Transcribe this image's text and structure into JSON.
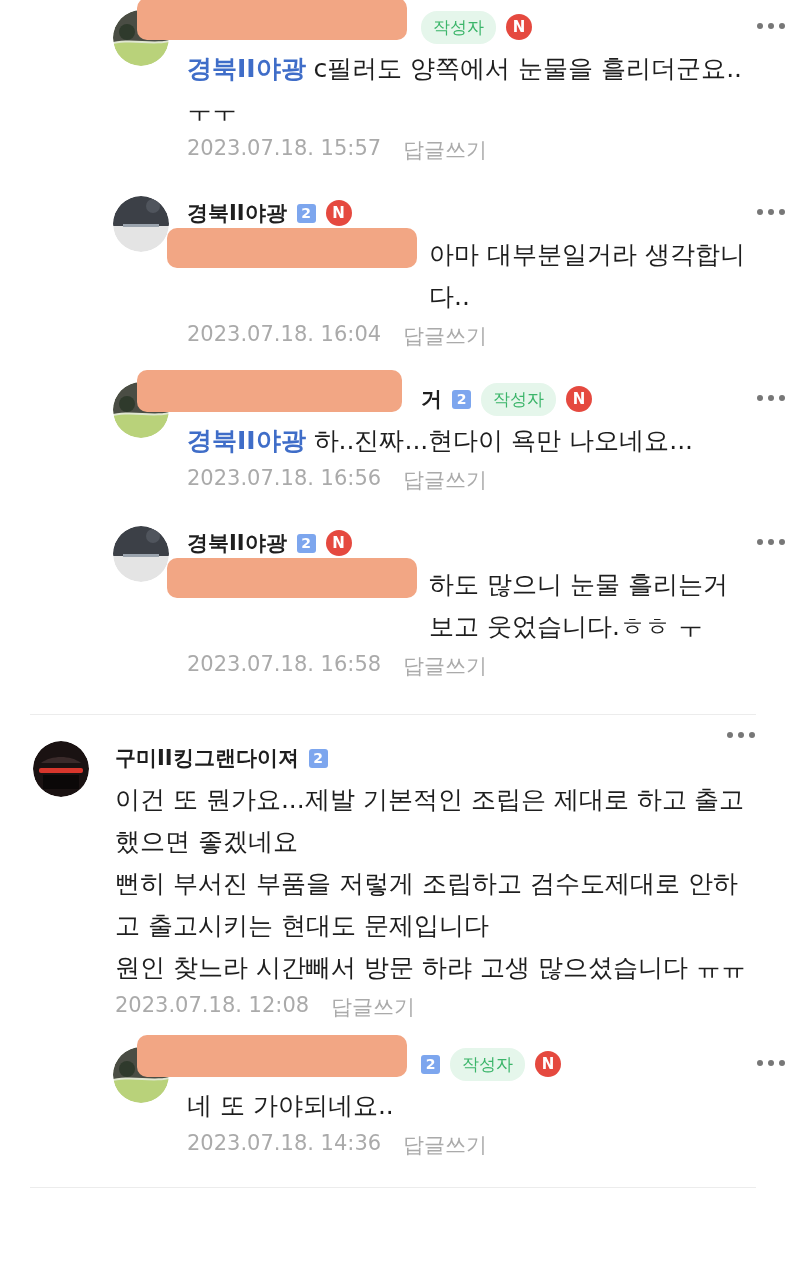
{
  "comments": [
    {
      "kind": "reply",
      "name_redacted": true,
      "author_tag": "작성자",
      "new_badge": "N",
      "mention": "경북II야광",
      "text": "c필러도 양쪽에서 눈물을 흘리더군요..ㅜㅜ",
      "date": "2023.07.18. 15:57",
      "reply_label": "답글쓰기"
    },
    {
      "kind": "reply",
      "author": "경북II야광",
      "level": "2",
      "new_badge": "N",
      "mention_redacted": true,
      "text": "아마 대부분일거라 생각합니다..",
      "date": "2023.07.18. 16:04",
      "reply_label": "답글쓰기"
    },
    {
      "kind": "reply",
      "name_redacted": true,
      "author": "거",
      "level": "2",
      "author_tag": "작성자",
      "new_badge": "N",
      "mention": "경북II야광",
      "text": "하..진짜...현다이 욕만 나오네요...",
      "date": "2023.07.18. 16:56",
      "reply_label": "답글쓰기"
    },
    {
      "kind": "reply",
      "author": "경북II야광",
      "level": "2",
      "new_badge": "N",
      "mention_redacted": true,
      "text": "하도 많으니 눈물 흘리는거 보고 웃었습니다.ㅎㅎ ㅜ",
      "date": "2023.07.18. 16:58",
      "reply_label": "답글쓰기"
    },
    {
      "kind": "top",
      "author": "구미II킹그랜다이져",
      "level": "2",
      "text": "이건 또 뭔가요...제발 기본적인 조립은 제대로 하고 출고했으면 좋겠네요\n뻔히 부서진 부품을 저렇게 조립하고 검수도제대로 안하고 출고시키는 현대도 문제입니다\n원인 찾느라 시간빼서 방문 하랴 고생 많으셨습니다 ㅠㅠ",
      "date": "2023.07.18. 12:08",
      "reply_label": "답글쓰기"
    },
    {
      "kind": "reply",
      "name_redacted": true,
      "level": "2",
      "author_tag": "작성자",
      "new_badge": "N",
      "text": "네 또 가야되네요..",
      "date": "2023.07.18. 14:36",
      "reply_label": "답글쓰기"
    }
  ]
}
